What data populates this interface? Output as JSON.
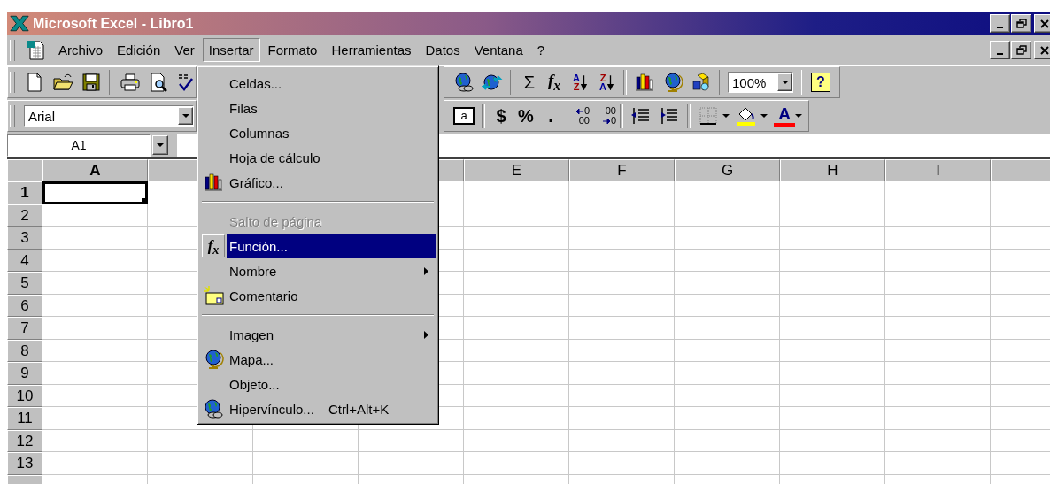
{
  "window": {
    "title": "Microsoft Excel - Libro1"
  },
  "menu_bar": [
    {
      "label": "Archivo",
      "selected": false
    },
    {
      "label": "Edición",
      "selected": false
    },
    {
      "label": "Ver",
      "selected": false
    },
    {
      "label": "Insertar",
      "selected": true
    },
    {
      "label": "Formato",
      "selected": false
    },
    {
      "label": "Herramientas",
      "selected": false
    },
    {
      "label": "Datos",
      "selected": false
    },
    {
      "label": "Ventana",
      "selected": false
    },
    {
      "label": "?",
      "selected": false
    }
  ],
  "standard_toolbar": {
    "autosum": "Σ",
    "paste_function": "f$_{x}$",
    "sort_ascending": [
      "A",
      "Z"
    ],
    "sort_descending": [
      "Z",
      "A"
    ],
    "zoom": "100%",
    "help": "?"
  },
  "formatting_toolbar": {
    "font": "Arial",
    "merge_center": "a",
    "currency": "$",
    "percent": "%",
    "comma": ".",
    "increase_decimal": [
      "0",
      "00"
    ],
    "decrease_decimal": [
      "00",
      "0"
    ],
    "font_color": "A"
  },
  "name_box": "A1",
  "columns": [
    {
      "label": "A",
      "selected": true
    },
    {},
    {},
    {},
    {
      "label": "E",
      "selected": false
    },
    {
      "label": "F",
      "selected": false
    },
    {
      "label": "G",
      "selected": false
    },
    {
      "label": "H",
      "selected": false
    },
    {
      "label": "I",
      "selected": false
    },
    {}
  ],
  "rows": [
    {
      "label": "1",
      "selected": true
    },
    {
      "label": "2",
      "selected": false
    },
    {
      "label": "3",
      "selected": false
    },
    {
      "label": "4",
      "selected": false
    },
    {
      "label": "5",
      "selected": false
    },
    {
      "label": "6",
      "selected": false
    },
    {
      "label": "7",
      "selected": false
    },
    {
      "label": "8",
      "selected": false
    },
    {
      "label": "9",
      "selected": false
    },
    {
      "label": "10",
      "selected": false
    },
    {
      "label": "11",
      "selected": false
    },
    {
      "label": "12",
      "selected": false
    },
    {
      "label": "13",
      "selected": false
    }
  ],
  "insert_menu": [
    {
      "kind": "item",
      "label": "Celdas...",
      "disabled": false,
      "selected": false,
      "submenu": false
    },
    {
      "kind": "item",
      "label": "Filas",
      "disabled": false,
      "selected": false,
      "submenu": false
    },
    {
      "kind": "item",
      "label": "Columnas",
      "disabled": false,
      "selected": false,
      "submenu": false
    },
    {
      "kind": "item",
      "label": "Hoja de cálculo",
      "disabled": false,
      "selected": false,
      "submenu": false
    },
    {
      "kind": "item",
      "label": "Gráfico...",
      "disabled": false,
      "selected": false,
      "submenu": false
    },
    {
      "kind": "separator"
    },
    {
      "kind": "item",
      "label": "Salto de página",
      "disabled": true,
      "selected": false,
      "submenu": false
    },
    {
      "kind": "item",
      "label": "Función...",
      "icon_text": "f$_{x}$",
      "disabled": false,
      "selected": true,
      "submenu": false
    },
    {
      "kind": "item",
      "label": "Nombre",
      "disabled": false,
      "selected": false,
      "submenu": true
    },
    {
      "kind": "item",
      "label": "Comentario",
      "disabled": false,
      "selected": false,
      "submenu": false
    },
    {
      "kind": "separator"
    },
    {
      "kind": "item",
      "label": "Imagen",
      "disabled": false,
      "selected": false,
      "submenu": true
    },
    {
      "kind": "item",
      "label": "Mapa...",
      "disabled": false,
      "selected": false,
      "submenu": false
    },
    {
      "kind": "item",
      "label": "Objeto...",
      "disabled": false,
      "selected": false,
      "submenu": false
    },
    {
      "kind": "item",
      "label": "Hipervínculo...",
      "shortcut": "Ctrl+Alt+K",
      "disabled": false,
      "selected": false,
      "submenu": false
    }
  ]
}
